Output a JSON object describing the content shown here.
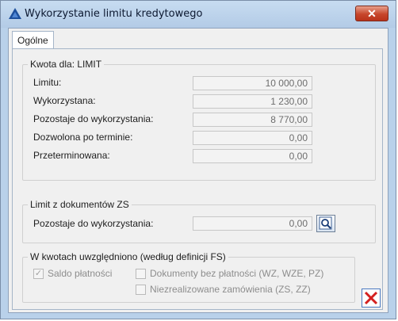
{
  "window": {
    "title": "Wykorzystanie limitu kredytowego"
  },
  "tabs": [
    {
      "label": "Ogólne"
    }
  ],
  "limit_group": {
    "legend": "Kwota dla: LIMIT",
    "rows": [
      {
        "label": "Limitu:",
        "value": "10 000,00"
      },
      {
        "label": "Wykorzystana:",
        "value": "1 230,00"
      },
      {
        "label": "Pozostaje do wykorzystania:",
        "value": "8 770,00"
      },
      {
        "label": "Dozwolona po terminie:",
        "value": "0,00"
      },
      {
        "label": "Przeterminowana:",
        "value": "0,00"
      }
    ]
  },
  "zs_group": {
    "legend": "Limit z dokumentów ZS",
    "label": "Pozostaje do wykorzystania:",
    "value": "0,00"
  },
  "included_group": {
    "legend": "W kwotach uwzględniono (według definicji FS)",
    "options": [
      {
        "label": "Saldo płatności",
        "checked": true
      },
      {
        "label": "Dokumenty bez płatności (WZ, WZE, PZ)",
        "checked": false
      },
      {
        "label": "Niezrealizowane zamówienia (ZS, ZZ)",
        "checked": false
      }
    ]
  },
  "icons": {
    "app": "app-logo-icon",
    "close": "close-icon",
    "lookup": "magnifier-icon",
    "cancel": "cancel-icon"
  },
  "colors": {
    "titlebar": "#b9d1ea",
    "close_button": "#c7462b",
    "cancel_x": "#d42020"
  }
}
